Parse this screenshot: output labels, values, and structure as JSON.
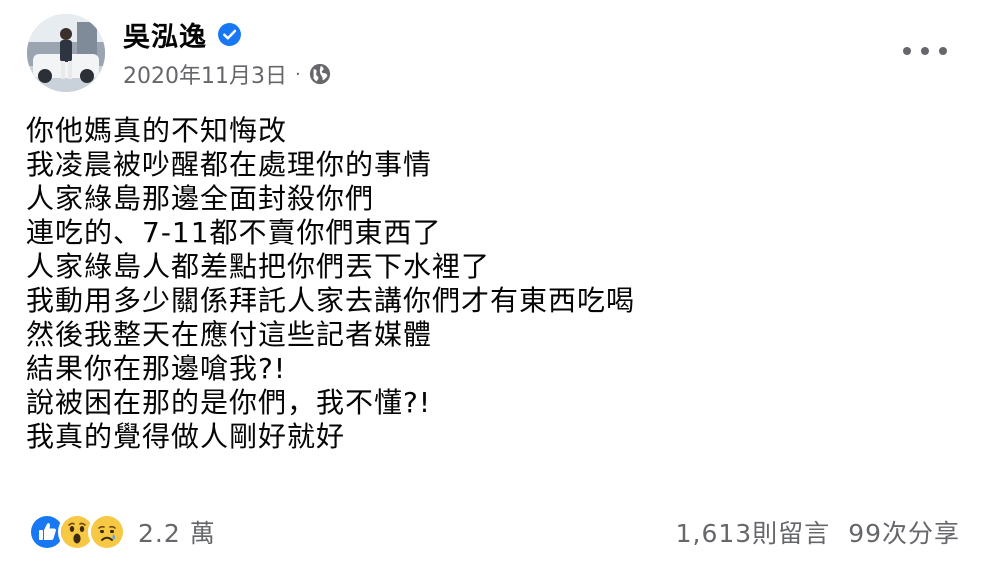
{
  "post": {
    "author": "吳泓逸",
    "verified": true,
    "date": "2020年11月3日",
    "separator": "·",
    "privacy_icon": "globe-icon",
    "lines": [
      "你他媽真的不知悔改",
      "我凌晨被吵醒都在處理你的事情",
      "人家綠島那邊全面封殺你們",
      "連吃的、7-11都不賣你們東西了",
      "人家綠島人都差點把你們丟下水裡了",
      "我動用多少關係拜託人家去講你們才有東西吃喝",
      "然後我整天在應付這些記者媒體",
      "結果你在那邊嗆我?!",
      "說被困在那的是你們，我不懂?!",
      "我真的覺得做人剛好就好"
    ]
  },
  "footer": {
    "reactions": [
      "like-icon",
      "wow-icon",
      "sad-icon"
    ],
    "reaction_count": "2.2 萬",
    "comments": "1,613則留言",
    "shares": "99次分享"
  },
  "colors": {
    "primary_text": "#050505",
    "secondary_text": "#65676b",
    "brand_blue": "#1877f2",
    "reaction_yellow": "#f7c844"
  }
}
